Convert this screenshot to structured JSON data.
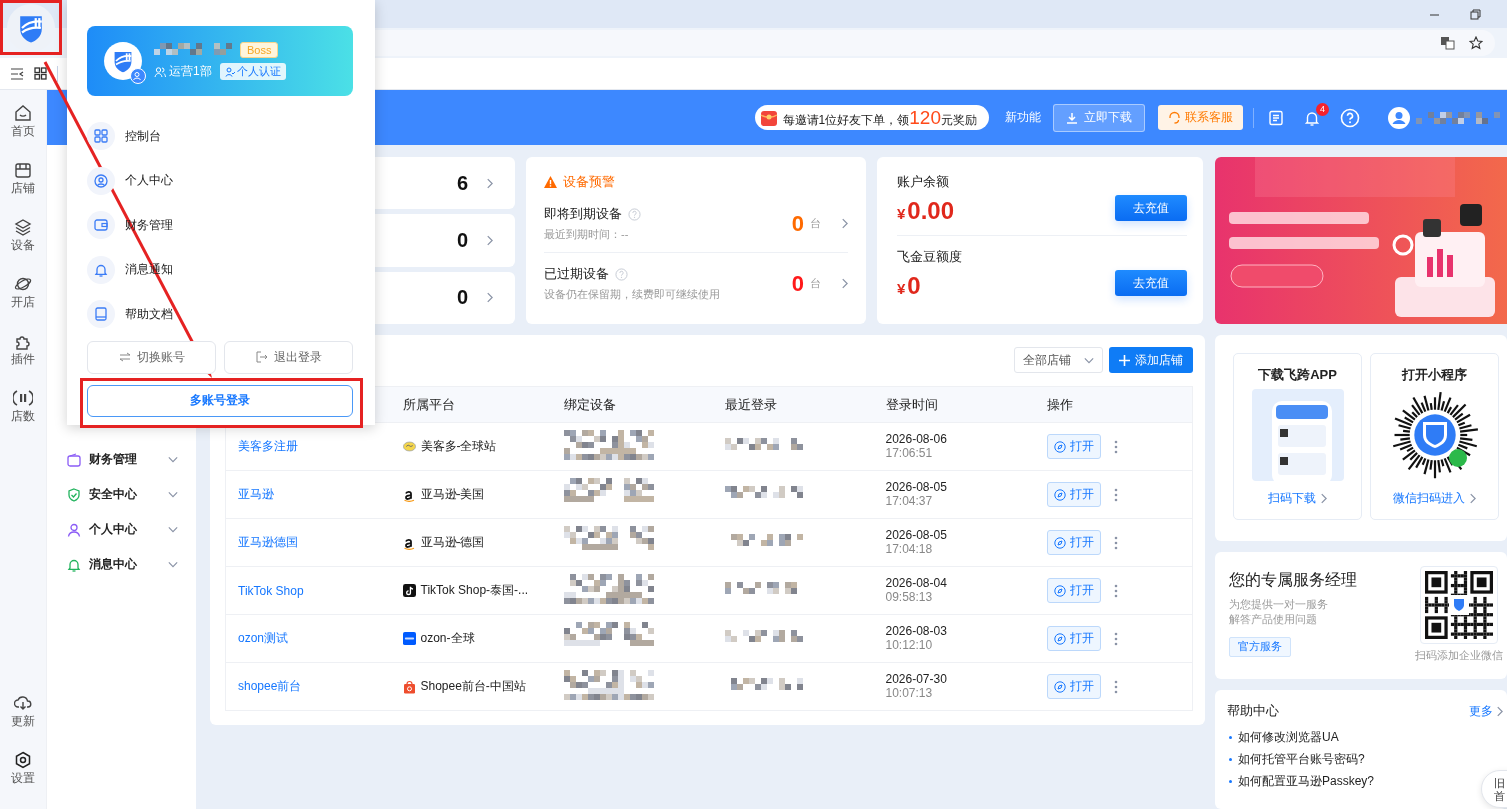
{
  "rail": {
    "items": [
      "首页",
      "店铺",
      "设备",
      "开店",
      "插件",
      "店数"
    ],
    "bottom": [
      "更新",
      "设置"
    ]
  },
  "sidebar": {
    "items": [
      "财务管理",
      "安全中心",
      "个人中心",
      "消息中心"
    ]
  },
  "header": {
    "promo": {
      "before": "每邀请1位好友下单，领",
      "amount": "120",
      "after": "元奖励"
    },
    "new_feature": "新功能",
    "download": "立即下载",
    "support": "联系客服",
    "notification_count": "4"
  },
  "stats": [
    {
      "value": "6"
    },
    {
      "value": "0"
    },
    {
      "value": "0"
    }
  ],
  "warning": {
    "title": "设备预警",
    "items": [
      {
        "label": "即将到期设备",
        "note": "最近到期时间：--",
        "count": "0",
        "unit": "台",
        "color": "#ff6a00"
      },
      {
        "label": "已过期设备",
        "note": "设备仍在保留期，续费即可继续使用",
        "count": "0",
        "unit": "台",
        "color": "#ff1a1a"
      }
    ]
  },
  "balance": [
    {
      "label": "账户余额",
      "currency": "¥",
      "amount": "0.00",
      "button": "去充值"
    },
    {
      "label": "飞金豆额度",
      "currency": "¥",
      "amount": "0",
      "button": "去充值"
    }
  ],
  "shops": {
    "filter": "全部店铺",
    "add_button": "添加店铺",
    "columns": [
      "所属平台",
      "绑定设备",
      "最近登录",
      "登录时间",
      "操作"
    ],
    "rows": [
      {
        "name": "美客多注册",
        "platform": "美客多-全球站",
        "kind": "mercado",
        "date": "2026-08-06",
        "time": "17:06:51",
        "action": "打开"
      },
      {
        "name": "亚马逊",
        "platform": "亚马逊-美国",
        "kind": "amazon",
        "date": "2026-08-05",
        "time": "17:04:37",
        "action": "打开"
      },
      {
        "name": "亚马逊德国",
        "platform": "亚马逊-德国",
        "kind": "amazon",
        "date": "2026-08-05",
        "time": "17:04:18",
        "action": "打开"
      },
      {
        "name": "TikTok Shop",
        "platform": "TikTok Shop-泰国-...",
        "kind": "tiktok",
        "date": "2026-08-04",
        "time": "09:58:13",
        "action": "打开"
      },
      {
        "name": "ozon测试",
        "platform": "ozon-全球",
        "kind": "ozon",
        "date": "2026-08-03",
        "time": "10:12:10",
        "action": "打开"
      },
      {
        "name": "shopee前台",
        "platform": "Shopee前台-中国站",
        "kind": "shopee",
        "date": "2026-07-30",
        "time": "10:07:13",
        "action": "打开"
      }
    ]
  },
  "app_cards": [
    {
      "title": "下载飞跨APP",
      "link": "扫码下载",
      "kind": "phone"
    },
    {
      "title": "打开小程序",
      "link": "微信扫码进入",
      "kind": "miniprogram"
    }
  ],
  "manager": {
    "title": "您的专属服务经理",
    "lines": [
      "为您提供一对一服务",
      "解答产品使用问题"
    ],
    "tag": "官方服务",
    "caption": "扫码添加企业微信"
  },
  "help": {
    "title": "帮助中心",
    "more": "更多",
    "items": [
      "如何修改浏览器UA",
      "如何托管平台账号密码?",
      "如何配置亚马逊Passkey?"
    ]
  },
  "popup": {
    "role": "Boss",
    "department": "运营1部",
    "verify": "个人认证",
    "menu": [
      "控制台",
      "个人中心",
      "财务管理",
      "消息通知",
      "帮助文档"
    ],
    "switch": "切换账号",
    "logout": "退出登录",
    "multi_login": "多账号登录"
  },
  "old_home": [
    "旧",
    "首"
  ]
}
